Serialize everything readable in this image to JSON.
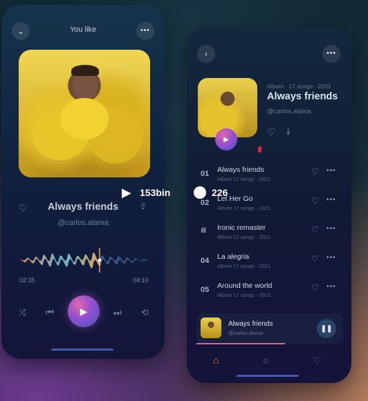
{
  "left_player": {
    "header_title": "You like",
    "song_title": "Always friends",
    "artist": "@carlos.alama",
    "time_elapsed": "02:35",
    "time_total": "04:10"
  },
  "overlay": {
    "views": "153bin",
    "comments": "226"
  },
  "album": {
    "meta": "Album · 17 songs · 2021",
    "title": "Always friends",
    "artist": "@carlos.alama",
    "tracks": [
      {
        "number": "01",
        "title": "Always friends",
        "subtitle": "Album 17 songs · 2021"
      },
      {
        "number": "02",
        "title": "Let Her Go",
        "subtitle": "Album 17 songs · 2021"
      },
      {
        "number": "",
        "title": "Ironic remaster",
        "subtitle": "Album 17 songs · 2021"
      },
      {
        "number": "04",
        "title": "La alegria",
        "subtitle": "Album 17 songs · 2021"
      },
      {
        "number": "05",
        "title": "Around the world",
        "subtitle": "Album 17 songs · 2021"
      }
    ]
  },
  "mini_player": {
    "title": "Always friends",
    "artist": "@carlos.alama"
  },
  "colors": {
    "accent_pink": "#e06aa9",
    "accent_purple": "#9a4fd0",
    "accent_blue": "#3c58c4",
    "home_tab_active": "#e6804a",
    "live_indicator": "#e0223a"
  }
}
